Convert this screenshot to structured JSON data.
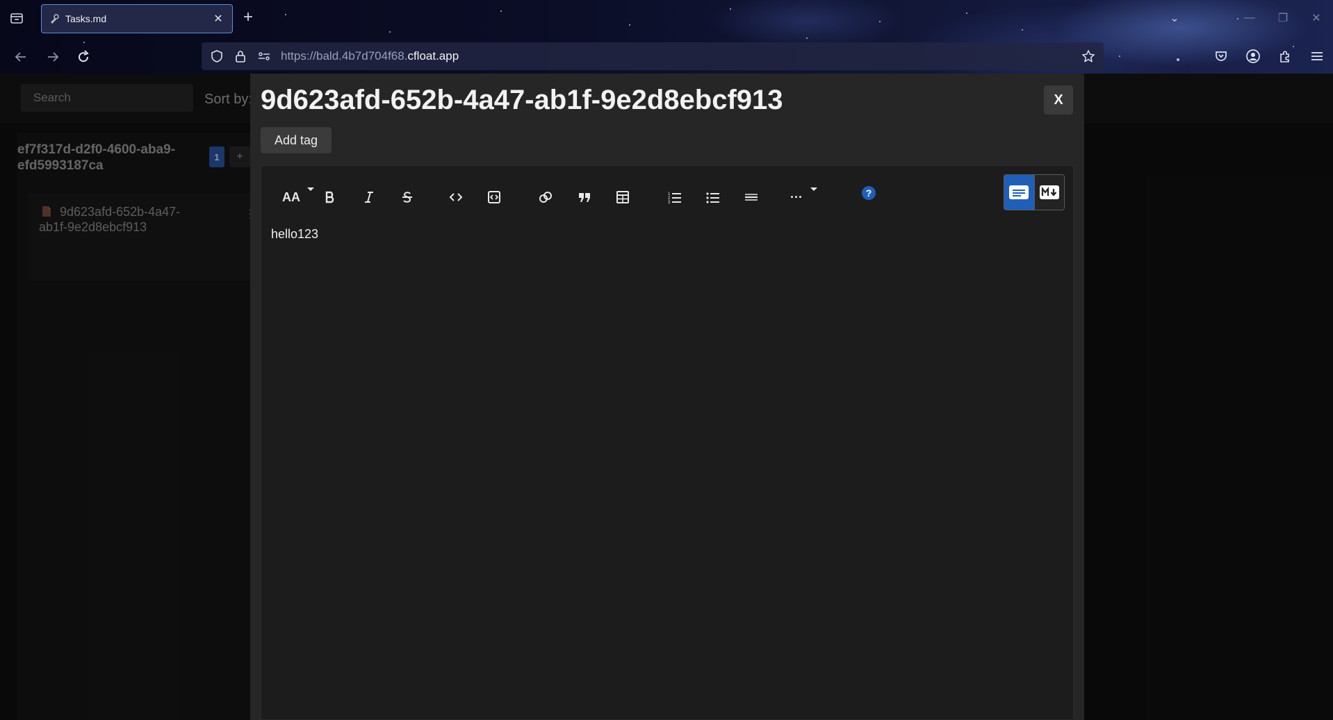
{
  "browser": {
    "tab_title": "Tasks.md",
    "url_prefix": "https://bald.4b7d704f68.",
    "url_host": "cfloat.app"
  },
  "app": {
    "search_placeholder": "Search",
    "sort_label": "Sort by:",
    "lane": {
      "title": "ef7f317d-d2f0-4600-aba9-efd5993187ca",
      "count": "1",
      "add_label": "+"
    },
    "card": {
      "title": "9d623afd-652b-4a47-ab1f-9e2d8ebcf913",
      "menu": "⋮"
    }
  },
  "modal": {
    "title": "9d623afd-652b-4a47-ab1f-9e2d8ebcf913",
    "close_label": "X",
    "add_tag_label": "Add tag",
    "editor_content": "hello123",
    "toolbar": {
      "heading_label": "AA",
      "more_label": "···",
      "help_icon_color": "#1f5fb8"
    }
  }
}
